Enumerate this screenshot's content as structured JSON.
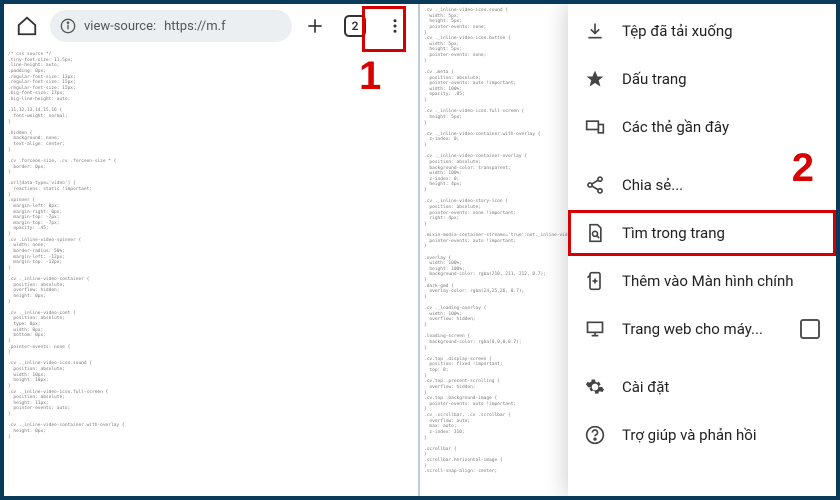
{
  "toolbar": {
    "url_prefix": "view-source:",
    "url": "https://m.f",
    "tab_count": "2"
  },
  "menu": {
    "downloads": "Tệp đã tải xuống",
    "bookmarks": "Dấu trang",
    "recent_tabs": "Các thẻ gần đây",
    "share": "Chia sẻ...",
    "find": "Tìm trong trang",
    "add_home": "Thêm vào Màn hình chính",
    "desktop_site": "Trang web cho máy...",
    "settings": "Cài đặt",
    "help": "Trợ giúp và phản hồi"
  },
  "annotations": {
    "one": "1",
    "two": "2"
  },
  "source_sample": "/* css source */\n.tiny-font-size: 11.5px;\n.line-height: auto;\n.padding: 0px;\n.regular-font-size: 13px;\n.regular-font-size: 15px;\n.regular-font-size: 15px;\n.big-font-size: 17px;\n.big-line-height: auto;\n\n.11,12,13,14,15,16 {\n  font-weight: normal;\n}\n\n.hidden {\n  background: none;\n  text-align: center;\n}\n\n.cv .forceon-size, .cv .forceon-size * {\n  border: 0px;\n}\n\n.url[data-type='video'] {\n  reactions: static !important;\n}\n.spinner {\n  margin-left: 0px;\n  margin-right: 0px;\n  margin-top: -7px;\n  margin-top: -7px;\n  opacity: .45;\n}\n.cv .inline-video-spinner {\n  width: none;\n  border-radius: 50%;\n  margin-left: -12px;\n  margin-top: -12px;\n}\n\n.cv ._inline-video-container {\n  position: absolute;\n  overflow: hidden;\n  height: 0px;\n}\n\n.cv ._inline-video-cont {\n  position: absolute;\n  type: 0px;\n  width: 0px;\n  bottom: 0px;\n}\n.pointer-events: none {\n}\n\n.cv ._inline-video-icon.sound {\n  position: absolute;\n  width: 10px;\n  height: 10px;\n}\n.cv ._inline-video-icon.full-screen {\n  position: absolute;\n  height: 11px;\n  pointer-events: auto;\n}\n\n.cv ._inline-video-container.with-overlay {\n  height: 0px;\n}\n",
  "source_sample_right": ".cv ._inline-video-icon.sound {\n  width: 5px;\n  height: 5px;\n  pointer-events: none;\n}\n.cv ._inline-video-icon.button {\n  width: 5px;\n  height: 5px;\n  pointer-events: none;\n}\n\n.cv .meta {\n  position: absolute;\n  pointer-events: auto !important;\n  width: 100%;\n  opacity: .85;\n}\n\n.cv ._inline-video-icon.full-screen {\n  height: 5px;\n}\n\n.cv ._inline-video-container.with-overlay {\n  z-index: 0;\n}\n\n.cv ._inline-video-container-overlay {\n  position: absolute;\n  background-color: transparent;\n  width: 100%;\n  z-index: 0;\n  height: 4px;\n}\n\n.cv ._inline-video-story-icon {\n  position: absolute;\n  pointer-events: none !important;\n  right: 4px;\n}\n\n.mixin-media-container-streams='true':not._inline-video-container {\n  pointer-events: auto !important;\n}\n\n.overlay {\n  width: 100%;\n  height: 100%;\n  background-color: rgba(210, 211, 212, 0.7);\n}\n.dark-gmd {\n  overlay-color: rgba(24,25,26, 0.7);\n}\n\n.cv ._loading-overlay {\n  width: 100%;\n  overflow: hidden;\n}\n\n.loading-screen {\n  background-color: rgba(0,0,0,0.7);\n}\n\n.cv.top .display-screen {\n  position: fixed !important;\n  top: 0;\n}\n.cv.top .present-scrolling {\n  overflow: hidden;\n}\n.cv.top .background-image {\n  pointer-events: auto !important;\n}\n.cv .scrollbar, .cv .scrollbar {\n  overflow: auto;\n  max: auto;\n  z-index: 310;\n}\n\n.scrollbar {\n}\n.scrollbar.horizontal-image {\n}\n.scroll-snap-align: center;\n"
}
